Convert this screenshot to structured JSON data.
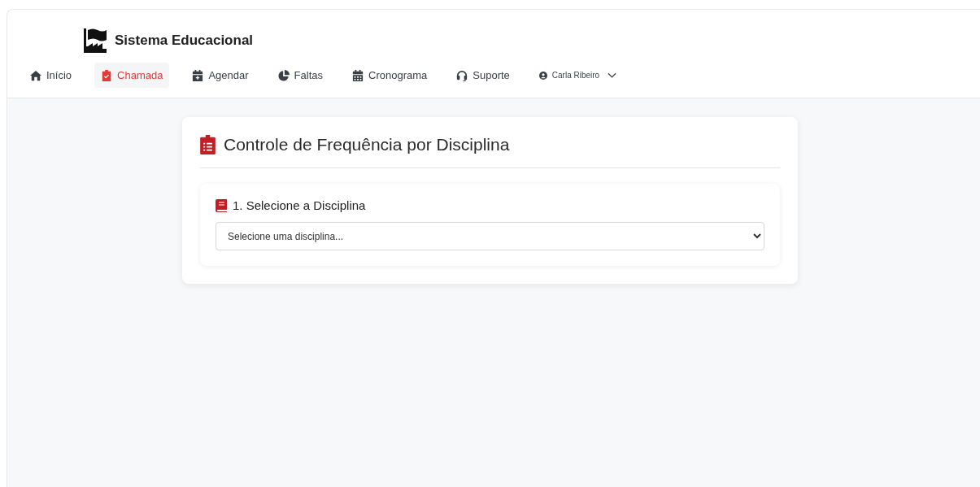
{
  "header": {
    "title": "Sistema Educacional"
  },
  "nav": [
    {
      "label": "Início",
      "selected": false
    },
    {
      "label": "Chamada",
      "selected": true
    },
    {
      "label": "Agendar",
      "selected": false
    },
    {
      "label": "Faltas",
      "selected": false
    },
    {
      "label": "Cronograma",
      "selected": false
    },
    {
      "label": "Suporte",
      "selected": false
    }
  ],
  "user": {
    "name": "Carla Ribeiro"
  },
  "card": {
    "title": "Controle de Frequência por Disciplina",
    "section": {
      "title": "1. Selecione a Disciplina",
      "select": {
        "placeholder": "Selecione uma disciplina..."
      }
    }
  }
}
